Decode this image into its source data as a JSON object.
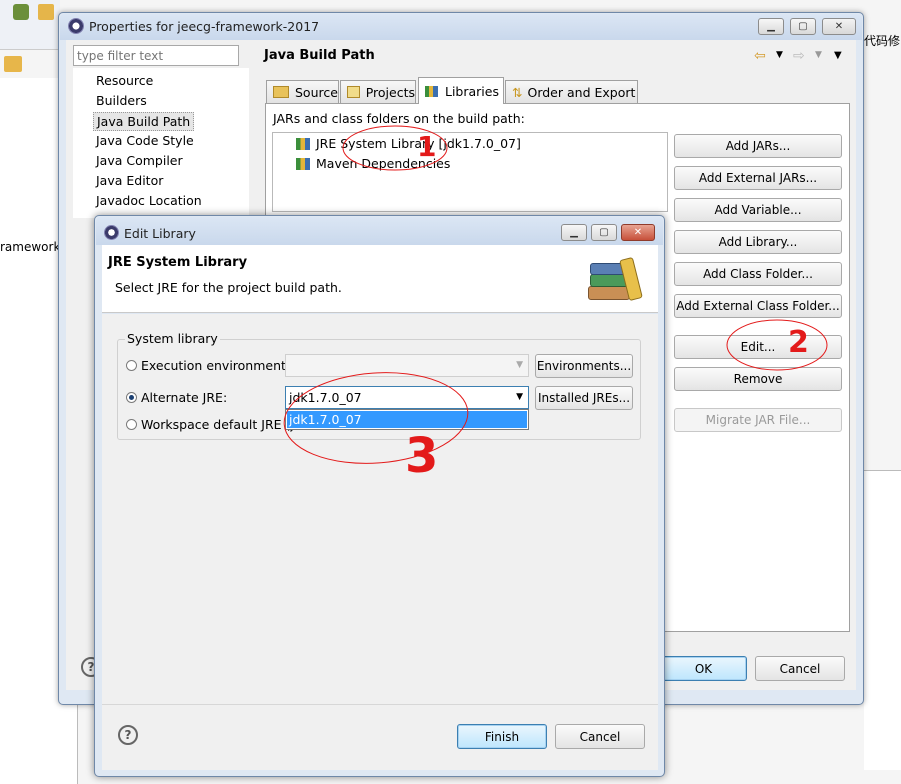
{
  "background": {
    "left_partial_text": "ramework]",
    "right_partial_text": "代码修"
  },
  "properties_dialog": {
    "title": "Properties for jeecg-framework-2017",
    "filter_placeholder": "type filter text",
    "tree_items": [
      "Resource",
      "Builders",
      "Java Build Path",
      "Java Code Style",
      "Java Compiler",
      "Java Editor",
      "Javadoc Location"
    ],
    "page_title": "Java Build Path",
    "tabs": [
      "Source",
      "Projects",
      "Libraries",
      "Order and Export"
    ],
    "libraries_label": "JARs and class folders on the build path:",
    "library_entries": [
      "JRE System Library [jdk1.7.0_07]",
      "Maven Dependencies"
    ],
    "buttons": {
      "add_jars": "Add JARs...",
      "add_external_jars": "Add External JARs...",
      "add_variable": "Add Variable...",
      "add_library": "Add Library...",
      "add_class_folder": "Add Class Folder...",
      "add_external_class_folder": "Add External Class Folder...",
      "edit": "Edit...",
      "remove": "Remove",
      "migrate_jar": "Migrate JAR File...",
      "ok": "OK",
      "cancel": "Cancel"
    }
  },
  "edit_library_dialog": {
    "title": "Edit Library",
    "header_title": "JRE System Library",
    "header_desc": "Select JRE for the project build path.",
    "group_label": "System library",
    "options": {
      "execution_env": "Execution environment:",
      "alternate_jre": "Alternate JRE:",
      "workspace_default": "Workspace default JRE (j"
    },
    "alternate_jre_value": "jdk1.7.0_07",
    "dropdown_options": [
      "jdk1.7.0_07"
    ],
    "buttons": {
      "environments": "Environments...",
      "installed_jres": "Installed JREs...",
      "finish": "Finish",
      "cancel": "Cancel"
    }
  },
  "annotations": [
    "1",
    "2",
    "3"
  ],
  "colors": {
    "accent": "#3399ff",
    "annotation": "#e31a1a"
  }
}
